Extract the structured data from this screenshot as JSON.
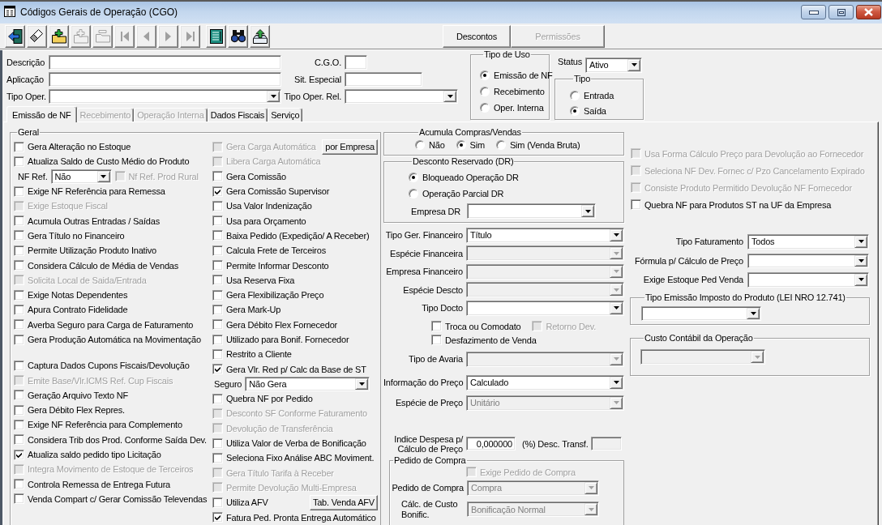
{
  "window": {
    "title": "Códigos Gerais de Operação (CGO)"
  },
  "toolbar": {
    "tools": [
      {
        "kind": "exit",
        "disabled": false
      },
      {
        "kind": "eraser",
        "disabled": false
      },
      {
        "kind": "add",
        "disabled": false
      },
      {
        "kind": "add",
        "disabled": true
      },
      {
        "kind": "remove",
        "disabled": true
      },
      {
        "kind": "first",
        "disabled": true
      },
      {
        "kind": "previous",
        "disabled": true
      },
      {
        "kind": "next",
        "disabled": true
      },
      {
        "kind": "last",
        "disabled": true
      },
      {
        "kind": "list",
        "disabled": false
      },
      {
        "kind": "find",
        "disabled": false
      },
      {
        "kind": "export",
        "disabled": false
      }
    ],
    "buttons": [
      {
        "label": "Descontos",
        "disabled": false
      },
      {
        "label": "Permissões",
        "disabled": true
      }
    ]
  },
  "header": {
    "rows": [
      [
        {
          "label": "Descrição",
          "kind": "text"
        },
        {
          "label": "C.G.O.",
          "kind": "text"
        }
      ],
      [
        {
          "label": "Aplicação",
          "kind": "text"
        },
        {
          "label": "Sit. Especial",
          "kind": "text"
        }
      ],
      [
        {
          "label": "Tipo Oper.",
          "kind": "combo"
        },
        {
          "label": "Tipo Oper. Rel.",
          "kind": "combo"
        }
      ]
    ],
    "tipo_de_uso": {
      "title": "Tipo de Uso",
      "options": [
        {
          "label": "Emissão de NF",
          "selected": true
        },
        {
          "label": "Recebimento",
          "selected": false
        },
        {
          "label": "Oper. Interna",
          "selected": false
        }
      ]
    },
    "status": {
      "label": "Status",
      "value": "Ativo"
    },
    "tipo": {
      "title": "Tipo",
      "options": [
        {
          "label": "Entrada",
          "selected": false
        },
        {
          "label": "Saída",
          "selected": true
        }
      ]
    }
  },
  "tabs": [
    {
      "label": "Emissão de NF",
      "selected": true,
      "disabled": false
    },
    {
      "label": "Recebimento",
      "selected": false,
      "disabled": true
    },
    {
      "label": "Operação Interna",
      "selected": false,
      "disabled": true
    },
    {
      "label": "Dados Fiscais",
      "selected": false,
      "disabled": false
    },
    {
      "label": "Serviço",
      "selected": false,
      "disabled": false
    }
  ],
  "emissao_nf": {
    "geral": {
      "title": "Geral",
      "column_1": [
        {
          "kind": "check",
          "label": "Gera Alteração no Estoque",
          "checked": false,
          "disabled": false
        },
        {
          "kind": "check",
          "label": "Atualiza Saldo de Custo Médio do Produto",
          "checked": false,
          "disabled": false
        },
        {
          "kind": "select",
          "label": "NF Ref.",
          "value": "Não",
          "disabled": false,
          "check": {
            "label": "Nf Ref. Prod Rural",
            "checked": false,
            "disabled": true
          }
        },
        {
          "kind": "check",
          "label": "Exige NF Referência para Remessa",
          "checked": false,
          "disabled": false
        },
        {
          "kind": "check",
          "label": "Exige Estoque Fiscal",
          "checked": false,
          "disabled": true
        },
        {
          "kind": "check",
          "label": "Acumula Outras Entradas / Saídas",
          "checked": false,
          "disabled": false
        },
        {
          "kind": "check",
          "label": "Gera Título no Financeiro",
          "checked": false,
          "disabled": false
        },
        {
          "kind": "check",
          "label": "Permite Utilização Produto Inativo",
          "checked": false,
          "disabled": false
        },
        {
          "kind": "check",
          "label": "Considera Cálculo de Média de Vendas",
          "checked": false,
          "disabled": false
        },
        {
          "kind": "check",
          "label": "Solicita Local de Saida/Entrada",
          "checked": false,
          "disabled": true
        },
        {
          "kind": "check",
          "label": "Exige Notas Dependentes",
          "checked": false,
          "disabled": false
        },
        {
          "kind": "check",
          "label": "Apura Contrato Fidelidade",
          "checked": false,
          "disabled": false
        },
        {
          "kind": "check",
          "label": "Averba Seguro para Carga de Faturamento",
          "checked": false,
          "disabled": false
        },
        {
          "kind": "check",
          "label": "Gera Produção Automática na Movimentação",
          "checked": false,
          "disabled": false
        },
        {
          "kind": "check",
          "label": "Captura Dados Cupons Fiscais/Devolução",
          "checked": false,
          "disabled": false
        },
        {
          "kind": "check",
          "label": "Emite Base/Vlr.ICMS Ref. Cup Fiscais",
          "checked": false,
          "disabled": true
        },
        {
          "kind": "check",
          "label": "Geração Arquivo Texto NF",
          "checked": false,
          "disabled": false
        },
        {
          "kind": "check",
          "label": "Gera Débito Flex Repres.",
          "checked": false,
          "disabled": false
        },
        {
          "kind": "check",
          "label": "Exige NF Referência para Complemento",
          "checked": false,
          "disabled": false
        },
        {
          "kind": "check",
          "label": "Considera Trib dos Prod. Conforme Saída Dev.",
          "checked": false,
          "disabled": false
        },
        {
          "kind": "check",
          "label": "Atualiza saldo pedido tipo Licitação",
          "checked": true,
          "disabled": false
        },
        {
          "kind": "check",
          "label": "Integra Movimento de Estoque de Terceiros",
          "checked": false,
          "disabled": true
        },
        {
          "kind": "check",
          "label": "Controla Remessa de Entrega Futura",
          "checked": false,
          "disabled": false
        },
        {
          "kind": "check",
          "label": "Venda Compart c/ Gerar Comissão Televendas",
          "checked": false,
          "disabled": false
        }
      ],
      "column_2": [
        {
          "kind": "check",
          "label": "Gera Carga Automática",
          "checked": false,
          "disabled": true,
          "button": "por Empresa"
        },
        {
          "kind": "check",
          "label": "Libera Carga Automática",
          "checked": false,
          "disabled": true
        },
        {
          "kind": "check",
          "label": "Gera Comissão",
          "checked": false,
          "disabled": false
        },
        {
          "kind": "check",
          "label": "Gera Comissão Supervisor",
          "checked": true,
          "disabled": false
        },
        {
          "kind": "check",
          "label": "Usa Valor Indenização",
          "checked": false,
          "disabled": false
        },
        {
          "kind": "check",
          "label": "Usa para Orçamento",
          "checked": false,
          "disabled": false
        },
        {
          "kind": "check",
          "label": "Baixa Pedido (Expedição/ A Receber)",
          "checked": false,
          "disabled": false
        },
        {
          "kind": "check",
          "label": "Calcula Frete de Terceiros",
          "checked": false,
          "disabled": false
        },
        {
          "kind": "check",
          "label": "Permite Informar Desconto",
          "checked": false,
          "disabled": false
        },
        {
          "kind": "check",
          "label": "Usa Reserva Fixa",
          "checked": false,
          "disabled": false
        },
        {
          "kind": "check",
          "label": "Gera Flexibilização Preço",
          "checked": false,
          "disabled": false
        },
        {
          "kind": "check",
          "label": "Gera Mark-Up",
          "checked": false,
          "disabled": false
        },
        {
          "kind": "check",
          "label": "Gera Débito Flex Fornecedor",
          "checked": false,
          "disabled": false
        },
        {
          "kind": "check",
          "label": "Utilizado para Bonif. Fornecedor",
          "checked": false,
          "disabled": false
        },
        {
          "kind": "check",
          "label": "Restrito a Cliente",
          "checked": false,
          "disabled": false
        },
        {
          "kind": "check",
          "label": "Gera Vlr. Red p/ Calc da Base de ST",
          "checked": true,
          "disabled": false
        },
        {
          "kind": "select",
          "label": "Seguro",
          "value": "Não Gera",
          "disabled": false
        },
        {
          "kind": "check",
          "label": "Quebra NF por Pedido",
          "checked": false,
          "disabled": false
        },
        {
          "kind": "check",
          "label": "Desconto SF Conforme Faturamento",
          "checked": false,
          "disabled": true
        },
        {
          "kind": "check",
          "label": "Devolução de Transferência",
          "checked": false,
          "disabled": true
        },
        {
          "kind": "check",
          "label": "Utiliza Valor de Verba de Bonificação",
          "checked": false,
          "disabled": false
        },
        {
          "kind": "check",
          "label": "Seleciona Fixo Análise ABC Moviment.",
          "checked": false,
          "disabled": false
        },
        {
          "kind": "check",
          "label": "Gera Título Tarifa à Receber",
          "checked": false,
          "disabled": true
        },
        {
          "kind": "check",
          "label": "Permite Devolução Multi-Empresa",
          "checked": false,
          "disabled": true
        },
        {
          "kind": "check",
          "label": "Utiliza AFV",
          "checked": false,
          "disabled": false,
          "button": "Tab. Venda AFV"
        },
        {
          "kind": "check",
          "label": "Fatura Ped. Pronta Entrega Automático",
          "checked": true,
          "disabled": false
        }
      ]
    },
    "acumula_compras_vendas": {
      "title": "Acumula Compras/Vendas",
      "options": [
        {
          "label": "Não",
          "selected": false
        },
        {
          "label": "Sim",
          "selected": true
        },
        {
          "label": "Sim (Venda Bruta)",
          "selected": false
        }
      ]
    },
    "desconto_reservado": {
      "title": "Desconto Reservado (DR)",
      "options": [
        {
          "label": "Bloqueado Operação DR",
          "selected": true
        },
        {
          "label": "Operação Parcial DR",
          "selected": false
        }
      ],
      "empresa_dr": {
        "label": "Empresa DR",
        "disabled": false
      }
    },
    "financeiro": [
      {
        "kind": "combo",
        "label": "Tipo Ger. Financeiro",
        "value": "Título",
        "disabled": false
      },
      {
        "kind": "combo",
        "label": "Espécie Financeira",
        "disabled": true
      },
      {
        "kind": "combo",
        "label": "Empresa Financeiro",
        "disabled": true
      },
      {
        "kind": "combo",
        "label": "Espécie Descto",
        "disabled": true
      },
      {
        "kind": "combo",
        "label": "Tipo Docto",
        "disabled": false
      },
      {
        "kind": "checks",
        "items": [
          {
            "label": "Troca ou Comodato",
            "checked": false,
            "disabled": false
          },
          {
            "label": "Retorno Dev.",
            "checked": false,
            "disabled": true
          }
        ]
      },
      {
        "kind": "checks",
        "items": [
          {
            "label": "Desfazimento de Venda",
            "checked": false,
            "disabled": false
          }
        ]
      },
      {
        "kind": "combo",
        "label": "Tipo de Avaria",
        "disabled": true
      },
      {
        "kind": "combo",
        "label": "Informação do Preço",
        "value": "Calculado",
        "disabled": false
      },
      {
        "kind": "combo",
        "label": "Espécie de Preço",
        "value": "Unitário",
        "disabled": true
      }
    ],
    "indice_despesa": {
      "label": "Indice Despesa p/ Cálculo de Preço",
      "value": "0,000000"
    },
    "desc_transf": {
      "label": "(%) Desc. Transf.",
      "disabled": true
    },
    "pedido_de_compra": {
      "title": "Pedido de Compra",
      "exige": {
        "label": "Exige Pedido de Compra",
        "checked": false,
        "disabled": true
      },
      "fields": [
        {
          "label": "Pedido de Compra",
          "value": "Compra",
          "disabled": true
        },
        {
          "label": "Cálc. de Custo Bonific.",
          "value": "Bonificação Normal",
          "disabled": true
        }
      ]
    },
    "devolucao": [
      {
        "label": "Usa Forma Cálculo Preço para Devolução ao Fornecedor",
        "checked": false,
        "disabled": true
      },
      {
        "label": "Seleciona NF Dev. Fornec c/ Pzo Cancelamento Expirado",
        "checked": false,
        "disabled": true
      },
      {
        "label": "Consiste Produto Permitido Devolução NF Fornecedor",
        "checked": false,
        "disabled": true
      },
      {
        "label": "Quebra NF para Produtos ST na UF da Empresa",
        "checked": false,
        "disabled": false
      }
    ],
    "faturamento": [
      {
        "label": "Tipo Faturamento",
        "value": "Todos",
        "disabled": false
      },
      {
        "label": "Fórmula p/ Cálculo de Preço",
        "disabled": false
      },
      {
        "label": "Exige Estoque Ped Venda",
        "disabled": false
      }
    ],
    "tipo_emissao_imposto": {
      "title": "Tipo Emissão Imposto do Produto (LEI NRO 12.741)",
      "disabled": false
    },
    "custo_contabil": {
      "title": "Custo Contábil da Operação",
      "disabled": true
    }
  }
}
